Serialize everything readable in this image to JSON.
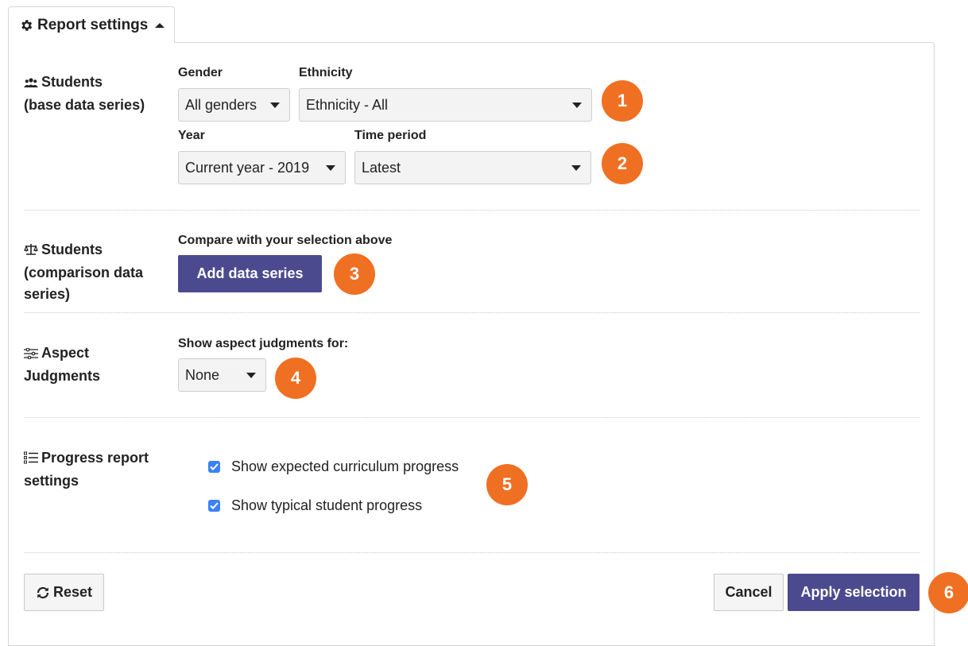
{
  "tab": {
    "label": "Report settings",
    "icon": "gear-icon"
  },
  "students_base": {
    "title_line1": "Students",
    "title_line2": "(base data series)",
    "gender": {
      "label": "Gender",
      "value": "All genders"
    },
    "ethnicity": {
      "label": "Ethnicity",
      "value": "Ethnicity - All"
    },
    "year": {
      "label": "Year",
      "value": "Current year - 2019"
    },
    "time_period": {
      "label": "Time period",
      "value": "Latest"
    }
  },
  "students_comparison": {
    "title_line1": "Students",
    "title_line2": "(comparison data",
    "title_line3": "series)",
    "compare_label": "Compare with your selection above",
    "add_button": "Add data series"
  },
  "aspect": {
    "title_line1": "Aspect",
    "title_line2": "Judgments",
    "label": "Show aspect judgments for:",
    "value": "None"
  },
  "progress": {
    "title_line1": "Progress report",
    "title_line2": "settings",
    "options": [
      {
        "label": "Show expected curriculum progress",
        "checked": true
      },
      {
        "label": "Show typical student progress",
        "checked": true
      }
    ]
  },
  "footer": {
    "reset": "Reset",
    "cancel": "Cancel",
    "apply": "Apply selection"
  },
  "badges": [
    "1",
    "2",
    "3",
    "4",
    "5",
    "6"
  ],
  "colors": {
    "accent": "#4c4a8f",
    "badge": "#f07023",
    "checkbox": "#3b82f6"
  }
}
